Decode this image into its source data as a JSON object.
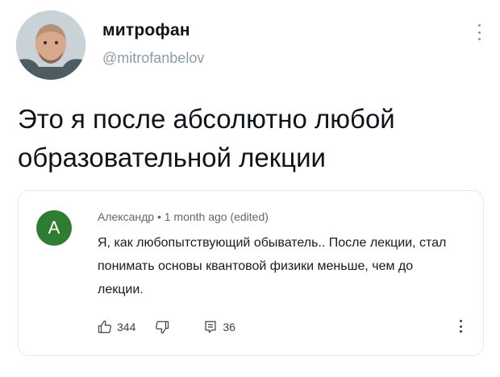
{
  "author": {
    "display_name": "митрофан",
    "handle": "@mitrofanbelov",
    "avatar_icon": "user-photo-avatar"
  },
  "tweet": {
    "text": "Это я после абсолютно любой образовательной лекции"
  },
  "embedded_comment": {
    "avatar_letter": "А",
    "avatar_color": "#2e7d32",
    "meta": "Александр • 1 month ago (edited)",
    "text": "Я, как любопытствующий обыватель.. После лекции, стал понимать основы квантовой физики меньше, чем до лекции.",
    "likes": "344",
    "replies": "36",
    "icons": {
      "like": "thumb-up-icon",
      "dislike": "thumb-down-icon",
      "reply": "reply-icon",
      "more": "more-vertical-icon"
    }
  },
  "colors": {
    "text": "#0f1419",
    "muted": "#8c9aa6",
    "card_border": "#e6e9ec"
  }
}
